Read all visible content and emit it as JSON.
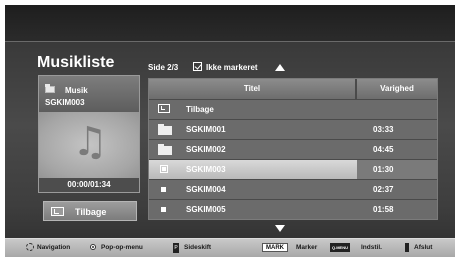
{
  "header": {
    "title": "Musikliste"
  },
  "now_playing": {
    "folder_label": "Musik",
    "name": "SGKIM003",
    "time": "00:00/01:34"
  },
  "back_button": {
    "label": "Tilbage"
  },
  "list_info": {
    "page": "Side 2/3",
    "mark_status": "Ikke markeret"
  },
  "table": {
    "columns": {
      "title": "Titel",
      "duration": "Varighed"
    },
    "rows": [
      {
        "icon": "up-folder-icon",
        "title": "Tilbage",
        "duration": ""
      },
      {
        "icon": "folder-icon",
        "title": "SGKIM001",
        "duration": "03:33"
      },
      {
        "icon": "folder-icon",
        "title": "SGKIM002",
        "duration": "04:45"
      },
      {
        "icon": "file-icon",
        "title": "SGKIM003",
        "duration": "01:30",
        "selected": true
      },
      {
        "icon": "file-icon",
        "title": "SGKIM004",
        "duration": "02:37"
      },
      {
        "icon": "file-icon",
        "title": "SGKIM005",
        "duration": "01:58"
      }
    ]
  },
  "footer": {
    "navigation": "Navigation",
    "popup": "Pop-op-menu",
    "page_switch": "Sideskift",
    "mark_key": "MARK",
    "mark": "Marker",
    "menu_key": "Q.MENU",
    "settings": "Indstil.",
    "exit": "Afslut"
  }
}
